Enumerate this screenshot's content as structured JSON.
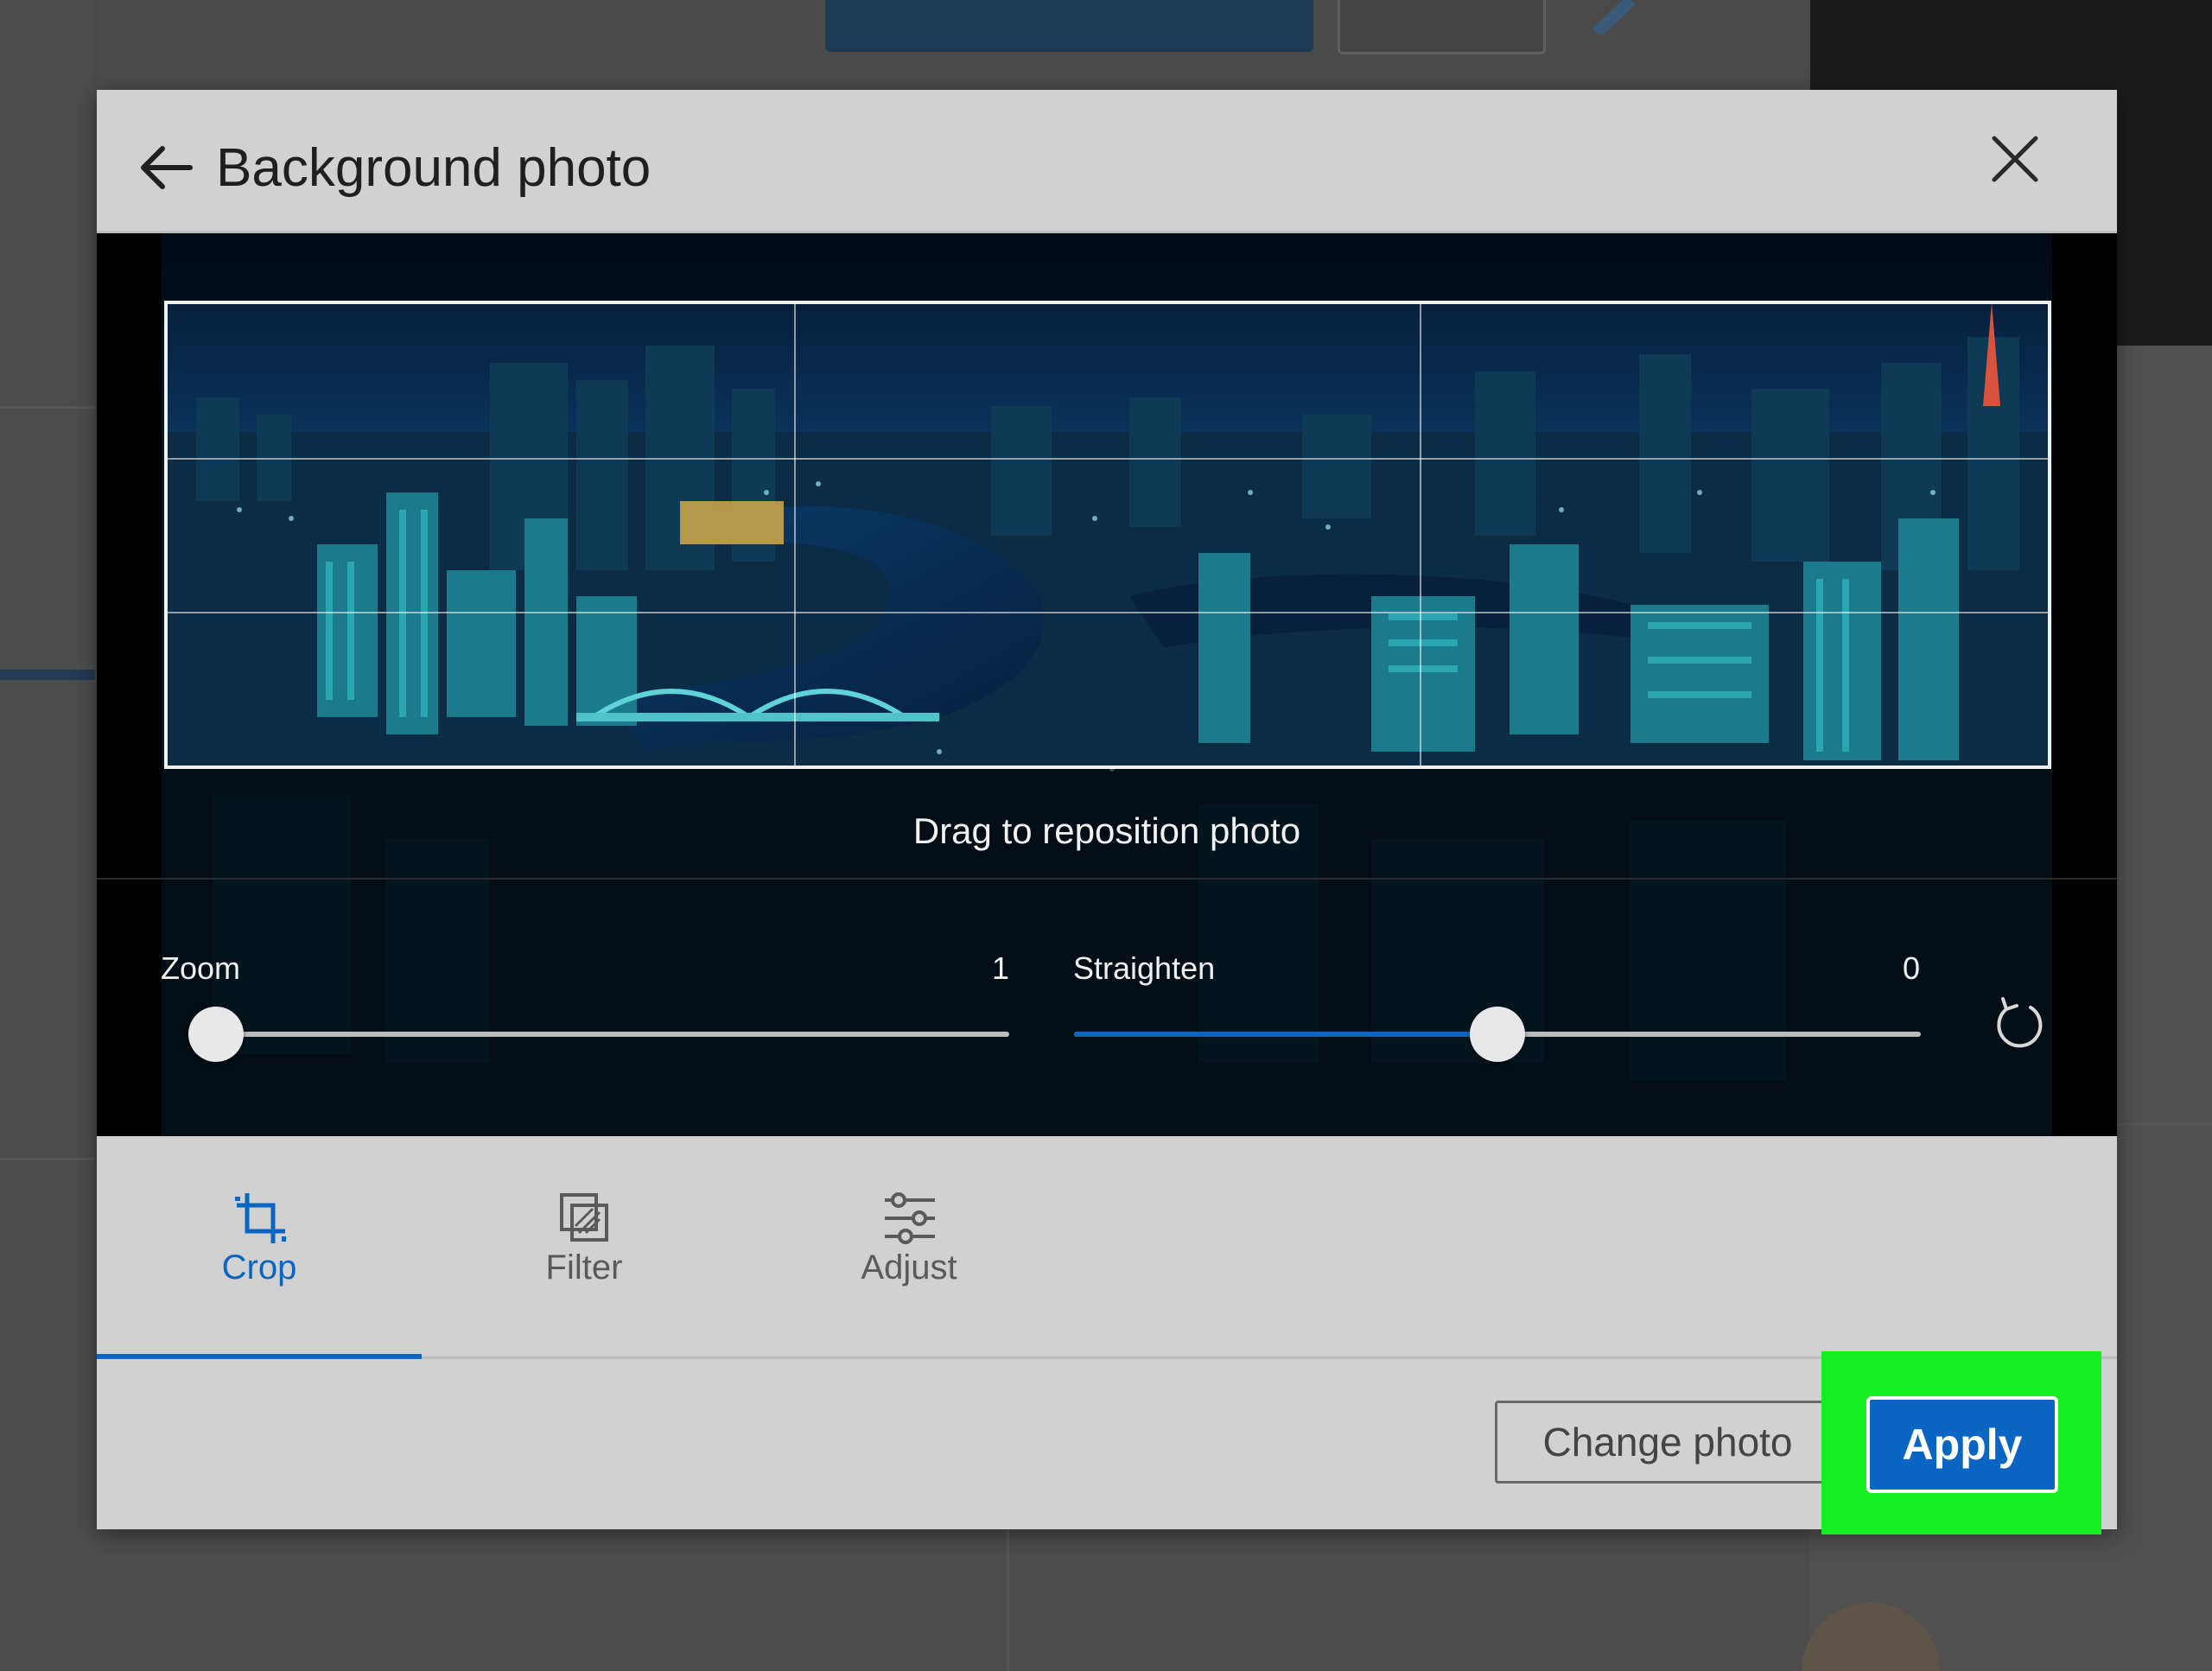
{
  "modal": {
    "title": "Background photo",
    "back_icon": "arrow-left-icon",
    "close_icon": "close-icon"
  },
  "editor": {
    "drag_hint": "Drag to reposition photo",
    "zoom": {
      "label": "Zoom",
      "value": "1",
      "level": 0.0
    },
    "straighten": {
      "label": "Straighten",
      "value": "0",
      "level": 0.5
    },
    "reset_icon": "rotate-reset-icon"
  },
  "tabs": [
    {
      "label": "Crop",
      "icon": "crop-icon",
      "active": true
    },
    {
      "label": "Filter",
      "icon": "filter-icon",
      "active": false
    },
    {
      "label": "Adjust",
      "icon": "sliders-icon",
      "active": false
    }
  ],
  "footer": {
    "change_photo_label": "Change photo",
    "apply_label": "Apply"
  },
  "colors": {
    "accent": "#0a66c2",
    "highlight": "#16ee21",
    "modal_bg": "#d1d1d1"
  }
}
